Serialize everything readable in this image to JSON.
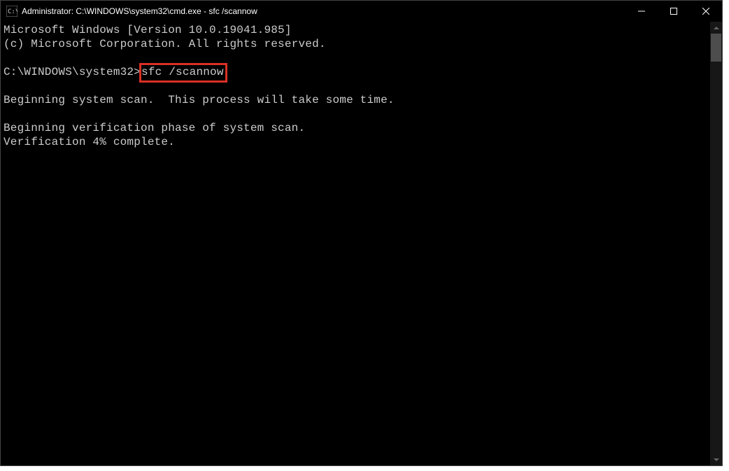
{
  "titlebar": {
    "title": "Administrator: C:\\WINDOWS\\system32\\cmd.exe - sfc  /scannow"
  },
  "terminal": {
    "line1": "Microsoft Windows [Version 10.0.19041.985]",
    "line2": "(c) Microsoft Corporation. All rights reserved.",
    "prompt": "C:\\WINDOWS\\system32>",
    "command": "sfc /scannow",
    "line3": "Beginning system scan.  This process will take some time.",
    "line4": "Beginning verification phase of system scan.",
    "line5": "Verification 4% complete."
  },
  "highlight_color": "#d93025"
}
